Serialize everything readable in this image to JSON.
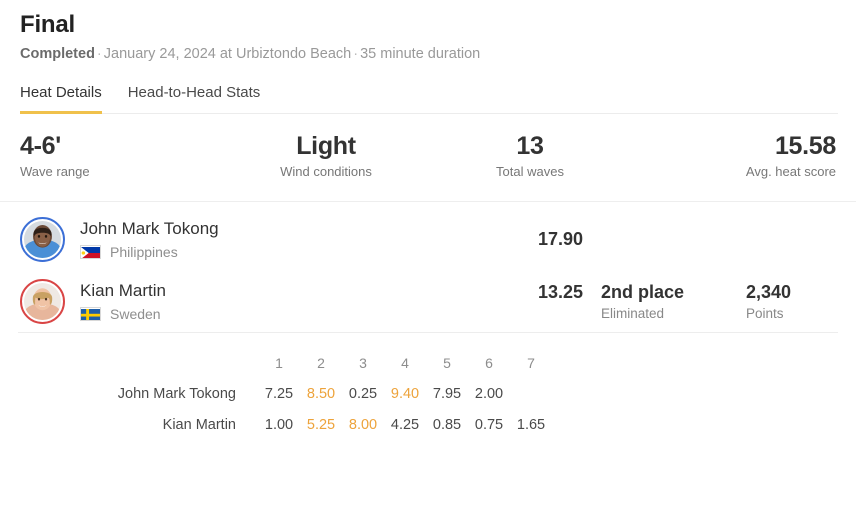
{
  "header": {
    "title": "Final",
    "status": "Completed",
    "separator": "·",
    "date_location": "January 24, 2024 at Urbiztondo Beach",
    "duration": "35 minute duration"
  },
  "tabs": [
    {
      "label": "Heat Details",
      "active": true
    },
    {
      "label": "Head-to-Head Stats",
      "active": false
    }
  ],
  "stats": [
    {
      "value": "4-6'",
      "label": "Wave range",
      "align": "left"
    },
    {
      "value": "Light",
      "label": "Wind conditions",
      "align": "center"
    },
    {
      "value": "13",
      "label": "Total waves",
      "align": "center"
    },
    {
      "value": "15.58",
      "label": "Avg. heat score",
      "align": "right"
    }
  ],
  "athletes": [
    {
      "name": "John Mark Tokong",
      "nation": "Philippines",
      "flag": "philippines-flag",
      "ring_color": "#3c6fd6",
      "total_score": "17.90",
      "place": "",
      "place_sub": "",
      "points": "",
      "points_label": ""
    },
    {
      "name": "Kian Martin",
      "nation": "Sweden",
      "flag": "sweden-flag",
      "ring_color": "#d94545",
      "total_score": "13.25",
      "place": "2nd place",
      "place_sub": "Eliminated",
      "points": "2,340",
      "points_label": "Points"
    }
  ],
  "wave_table": {
    "columns": [
      "1",
      "2",
      "3",
      "4",
      "5",
      "6",
      "7"
    ],
    "rows": [
      {
        "athlete": "John Mark Tokong",
        "scores": [
          "7.25",
          "8.50",
          "0.25",
          "9.40",
          "7.95",
          "2.00",
          ""
        ],
        "highlight": [
          false,
          true,
          false,
          true,
          false,
          false,
          false
        ]
      },
      {
        "athlete": "Kian Martin",
        "scores": [
          "1.00",
          "5.25",
          "8.00",
          "4.25",
          "0.85",
          "0.75",
          "1.65"
        ],
        "highlight": [
          false,
          true,
          true,
          false,
          false,
          false,
          false
        ]
      }
    ]
  },
  "colors": {
    "accent": "#f0c14b",
    "highlight_score": "#eda33b",
    "text_primary": "#333333",
    "text_muted": "#8e8e8e",
    "divider": "#ededed"
  }
}
